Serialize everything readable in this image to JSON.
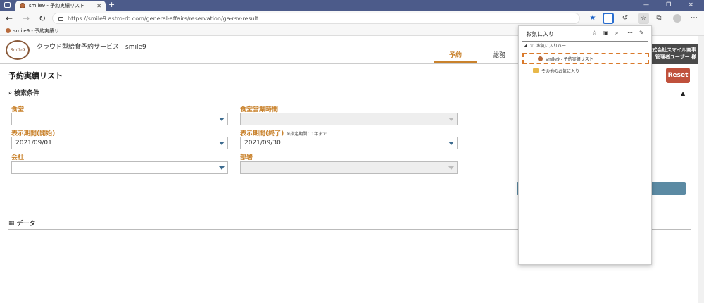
{
  "browser": {
    "tab_title": "smile9 - 予約実績リスト",
    "tab_close": "✕",
    "new_tab": "+",
    "url": "https://smile9.astro-rb.com/general-affairs/reservation/ga-rsv-result",
    "favorites_bar_item": "smile9 - 予約実績リ...",
    "window_controls": [
      "—",
      "❐",
      "✕"
    ],
    "nav_back": "←",
    "nav_forward": "→",
    "nav_reload": "↻"
  },
  "app": {
    "logo_text": "Smile9",
    "title": "クラウド型給食予約サービス　smile9",
    "nav": [
      {
        "label": "予約",
        "active": true
      },
      {
        "label": "総務",
        "active": false
      }
    ],
    "user_line1": "式会社スマイル商事",
    "user_line2": "管理者ユーザー 様"
  },
  "page": {
    "title": "予約実績リスト",
    "reset_label": "Reset",
    "search_section": "検索条件",
    "data_section": "データ",
    "fields": {
      "cafeteria_label": "食堂",
      "cafeteria_value": "",
      "hours_label": "食堂営業時間",
      "hours_value": "",
      "start_label": "表示期間(開始)",
      "start_value": "2021/09/01",
      "end_label": "表示期間(終了)",
      "end_note": "※指定期間：1年まで",
      "end_value": "2021/09/30",
      "company_label": "会社",
      "company_value": "",
      "dept_label": "部署",
      "dept_value": ""
    }
  },
  "favorites_panel": {
    "title": "お気に入り",
    "favorites_bar_folder": "お気に入りバー",
    "item": "smile9 - 予約実績リスト",
    "other_folder": "その他のお気に入り"
  },
  "colors": {
    "accent": "#c9822c",
    "reset": "#c0513c",
    "titlebar": "#4c5b8a"
  }
}
